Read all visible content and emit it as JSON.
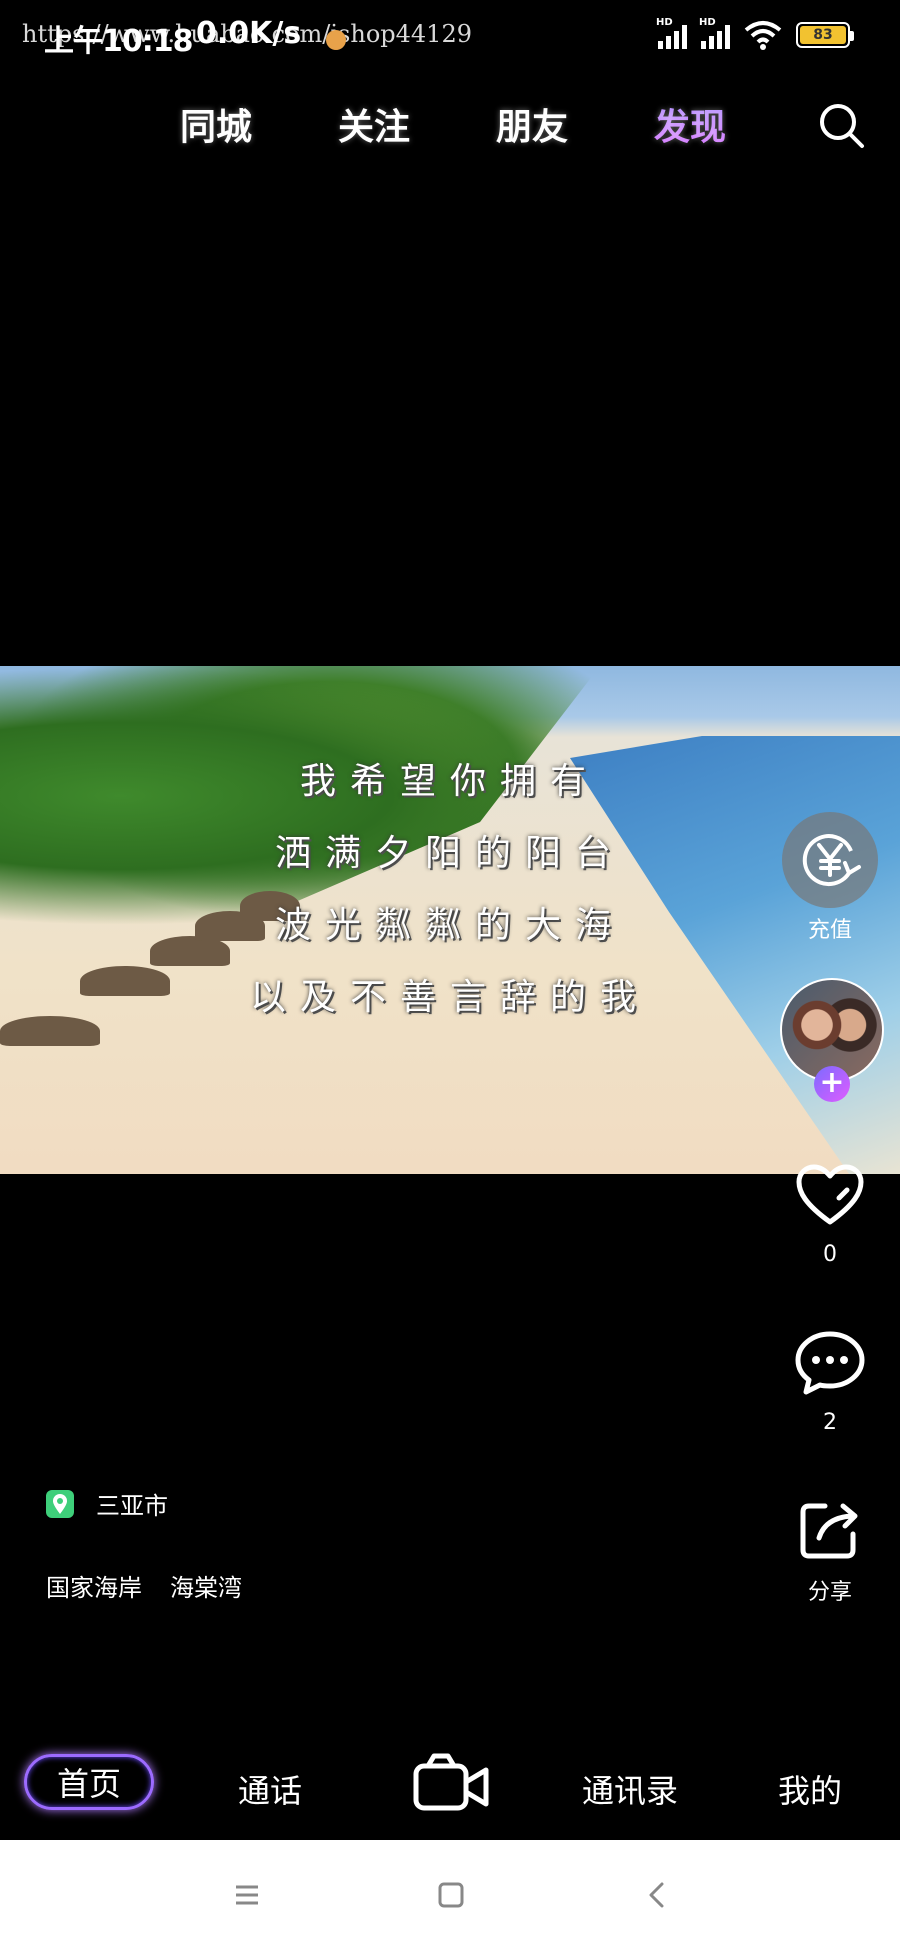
{
  "status_bar": {
    "time": "上午10:18",
    "net_speed": "0.0K/s",
    "watermark_url": "https://www.huabao.com/ishop44129",
    "signal1_label": "HD",
    "signal2_label": "HD",
    "battery_level": "83",
    "battery_color": "#f2c230"
  },
  "top_tabs": [
    {
      "label": "同城"
    },
    {
      "label": "关注"
    },
    {
      "label": "朋友"
    },
    {
      "label": "发现",
      "active": true
    }
  ],
  "search_icon": "search-icon",
  "video": {
    "lyrics": [
      "我希望你拥有",
      "洒满夕阳的阳台",
      "波光粼粼的大海",
      "以及不善言辞的我"
    ]
  },
  "actions": {
    "recharge_label": "充值",
    "like_count": "0",
    "comment_count": "2",
    "share_label": "分享"
  },
  "info": {
    "location": "三亚市",
    "tags": [
      "国家海岸",
      "海棠湾"
    ]
  },
  "bottom_nav": {
    "home": "首页",
    "calls": "通话",
    "contacts": "通讯录",
    "me": "我的",
    "accent": "#9c6bff"
  }
}
